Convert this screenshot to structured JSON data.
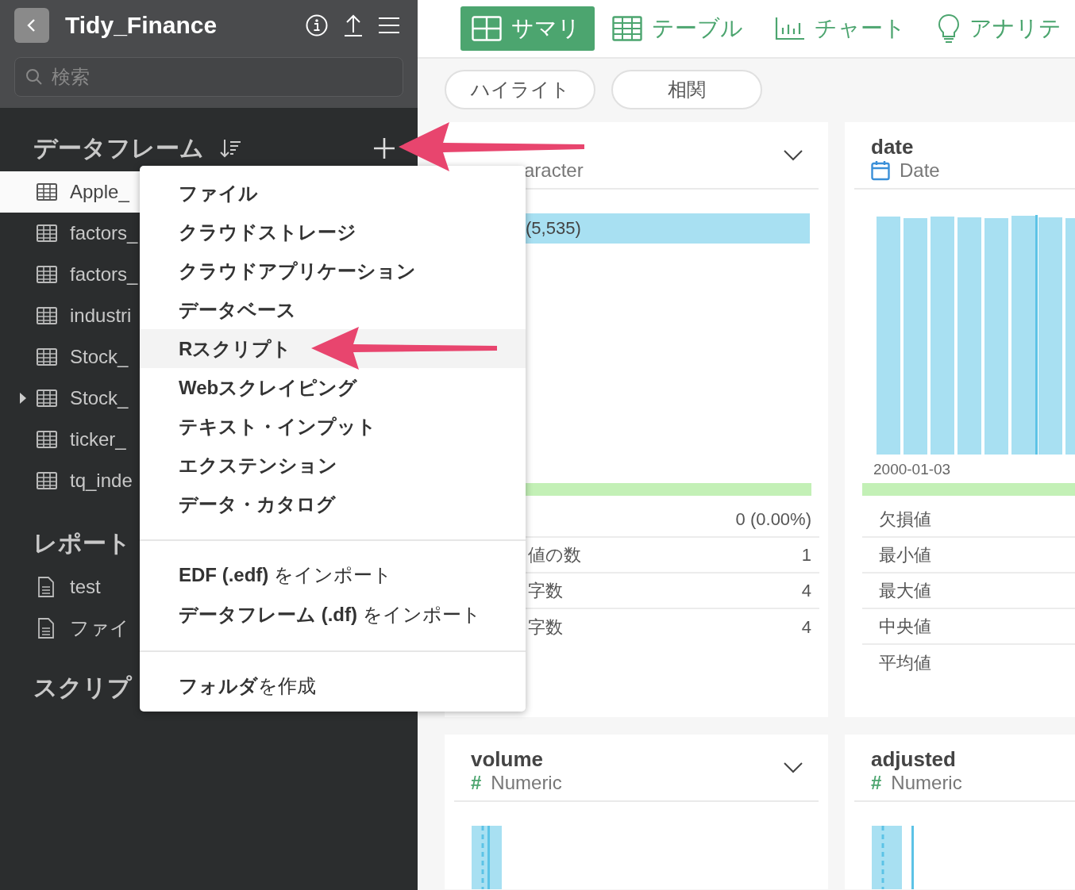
{
  "app": {
    "title": "Tidy_Finance",
    "search": {
      "placeholder": "検索"
    }
  },
  "sidebar": {
    "sections": [
      {
        "kind": "dataframes",
        "heading": "データフレーム",
        "items": [
          {
            "label": "Apple_",
            "selected": true,
            "expandable": false
          },
          {
            "label": "factors_",
            "selected": false,
            "expandable": false
          },
          {
            "label": "factors_",
            "selected": false,
            "expandable": false
          },
          {
            "label": "industri",
            "selected": false,
            "expandable": false
          },
          {
            "label": "Stock_",
            "selected": false,
            "expandable": false
          },
          {
            "label": "Stock_",
            "selected": false,
            "expandable": true
          },
          {
            "label": "ticker_",
            "selected": false,
            "expandable": false
          },
          {
            "label": "tq_inde",
            "selected": false,
            "expandable": false
          }
        ]
      },
      {
        "kind": "reports",
        "heading": "レポート",
        "items": [
          {
            "label": "test",
            "selected": false,
            "expandable": false
          },
          {
            "label": "ファイ",
            "selected": false,
            "expandable": false
          }
        ]
      },
      {
        "kind": "scripts",
        "heading": "スクリプ"
      }
    ]
  },
  "tabs": [
    {
      "kind": "summary",
      "label": "サマリ",
      "selected": true
    },
    {
      "kind": "table",
      "label": "テーブル",
      "selected": false
    },
    {
      "kind": "chart",
      "label": "チャート",
      "selected": false
    },
    {
      "kind": "analytics",
      "label": "アナリテ",
      "selected": false
    }
  ],
  "pills": [
    "ハイライト",
    "相関"
  ],
  "cards": [
    {
      "kind": "character",
      "type_label": "aracter",
      "collapsible": true,
      "top_value": "(5,535)",
      "stats": [
        {
          "value": "0 (0.00%)"
        },
        {
          "label": "値の数",
          "value": "1"
        },
        {
          "label": "字数",
          "value": "4"
        },
        {
          "label": "字数",
          "value": "4"
        }
      ]
    },
    {
      "kind": "date",
      "title": "date",
      "type_label": "Date",
      "axis_label": "2000-01-03",
      "stats": [
        {
          "label": "欠損値"
        },
        {
          "label": "最小値"
        },
        {
          "label": "最大値"
        },
        {
          "label": "中央値"
        },
        {
          "label": "平均値"
        }
      ]
    },
    {
      "kind": "numeric",
      "title": "volume",
      "type_symbol": "#",
      "type_label": "Numeric",
      "collapsible": true
    },
    {
      "kind": "numeric",
      "title": "adjusted",
      "type_symbol": "#",
      "type_label": "Numeric"
    }
  ],
  "menu": {
    "groups": [
      [
        {
          "label": "ファイル",
          "selected": false
        },
        {
          "label": "クラウドストレージ",
          "selected": false
        },
        {
          "label": "クラウドアプリケーション",
          "selected": false
        },
        {
          "label": "データベース",
          "selected": false
        },
        {
          "label": "Rスクリプト",
          "selected": true
        },
        {
          "label": "Webスクレイピング",
          "selected": false
        },
        {
          "label": "テキスト・インプット",
          "selected": false
        },
        {
          "label": "エクステンション",
          "selected": false
        },
        {
          "label": "データ・カタログ",
          "selected": false
        }
      ],
      [
        {
          "label": "**EDF (.edf)** をインポート",
          "selected": false
        },
        {
          "label": "**データフレーム (.df)** をインポート",
          "selected": false
        }
      ],
      [
        {
          "label": "**フォルダ**を作成",
          "selected": false
        }
      ]
    ]
  }
}
